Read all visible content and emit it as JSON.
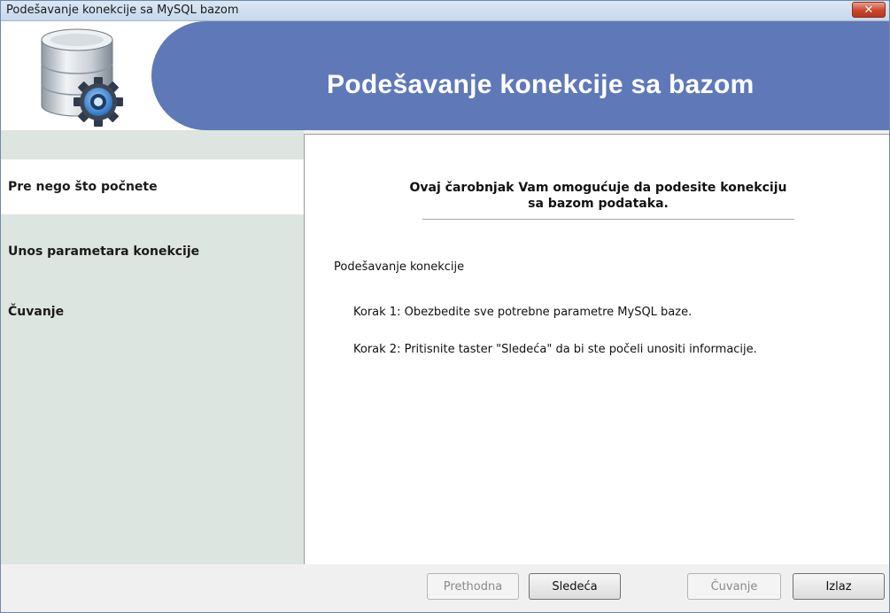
{
  "window": {
    "title": "Podešavanje konekcije sa MySQL bazom",
    "close_glyph": "✕"
  },
  "banner": {
    "heading": "Podešavanje konekcije sa bazom",
    "icon": "database-gear-icon",
    "accent_color": "#5f79b8"
  },
  "sidebar": {
    "items": [
      {
        "label": "Pre nego što počnete",
        "active": true
      },
      {
        "label": "Unos parametara konekcije",
        "active": false
      },
      {
        "label": "Čuvanje",
        "active": false
      }
    ]
  },
  "main": {
    "intro_line1": "Ovaj čarobnjak Vam omogućuje da podesite konekciju",
    "intro_line2": "sa bazom podataka.",
    "section_title": "Podešavanje konekcije",
    "step1": "Korak 1: Obezbedite sve potrebne parametre MySQL baze.",
    "step2": "Korak 2: Pritisnite taster \"Sledeća\" da bi ste počeli unositi informacije."
  },
  "buttons": {
    "previous": "Prethodna",
    "next": "Sledeća",
    "save": "Čuvanje",
    "exit": "Izlaz"
  }
}
